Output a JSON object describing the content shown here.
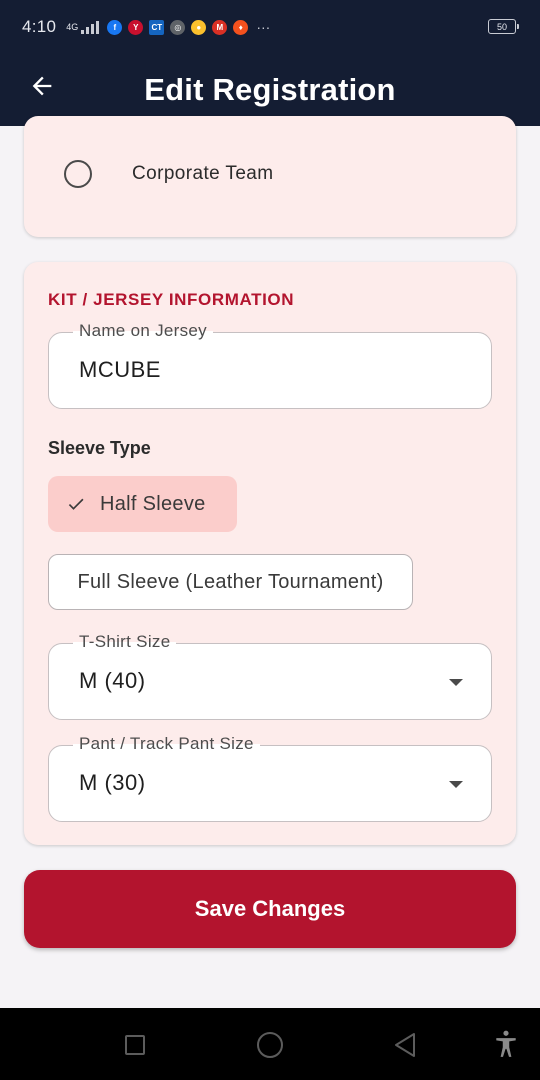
{
  "status_bar": {
    "time": "4:10",
    "network": "4G",
    "apps": [
      {
        "icon": "facebook-icon",
        "glyph": "f",
        "color": "#1877f2"
      },
      {
        "icon": "app-y-icon",
        "glyph": "Y",
        "color": "#c8102e"
      },
      {
        "icon": "ct-icon",
        "glyph": "CT",
        "color": "#1565c0"
      },
      {
        "icon": "chrome-icon",
        "glyph": "◎",
        "color": "#5f6368"
      },
      {
        "icon": "lens-icon",
        "glyph": "●",
        "color": "#fbc02d"
      },
      {
        "icon": "mail-icon",
        "glyph": "M",
        "color": "#d93025"
      },
      {
        "icon": "orange-app-icon",
        "glyph": "♦",
        "color": "#f4511e"
      }
    ],
    "more": "···",
    "battery": "50"
  },
  "app_bar": {
    "title": "Edit Registration"
  },
  "team_type": {
    "option_label": "Corporate Team"
  },
  "kit": {
    "section_title": "KIT / JERSEY INFORMATION",
    "name_on_jersey": {
      "label": "Name on Jersey",
      "value": "MCUBE"
    },
    "sleeve_type": {
      "title": "Sleeve Type",
      "options": [
        "Half Sleeve",
        "Full Sleeve (Leather Tournament)"
      ],
      "selected": "Half Sleeve"
    },
    "tshirt_size": {
      "label": "T-Shirt Size",
      "value": "M (40)"
    },
    "pant_size": {
      "label": "Pant / Track Pant Size",
      "value": "M (30)"
    }
  },
  "actions": {
    "save_label": "Save Changes"
  },
  "colors": {
    "header_bg": "#141d33",
    "card_bg": "#fdeceb",
    "accent": "#b3142e",
    "chip_selected_bg": "#fbcdcb"
  }
}
